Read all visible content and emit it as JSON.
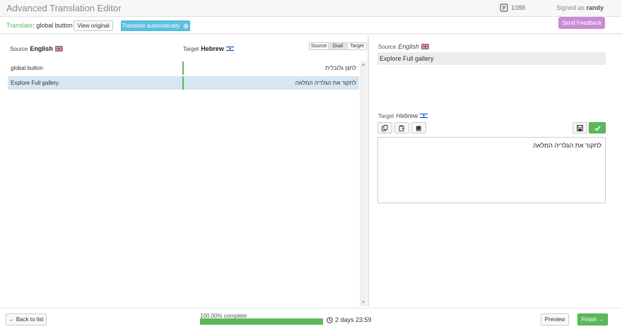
{
  "header": {
    "title": "Advanced Translation Editor",
    "credits": "1088",
    "signed_prefix": "Signed as",
    "user": "randy"
  },
  "subbar": {
    "translate_key": "Translate",
    "translate_value": ": global button",
    "view_original": "View original",
    "translate_auto": "Translate automatically",
    "send_feedback": "Send Feedback"
  },
  "list": {
    "source_label": "Source",
    "source_lang": "English",
    "target_label": "Target",
    "target_lang": "Hebrew",
    "view_modes": [
      "Source",
      "Dual",
      "Target"
    ],
    "active_mode": "Dual",
    "rows": [
      {
        "source": "global button",
        "target": "לחצן גלובלית",
        "selected": false
      },
      {
        "source": "Explore Full gallery",
        "target": "לחקור את הגלריה המלאה",
        "selected": true
      }
    ]
  },
  "editor": {
    "source_label": "Source",
    "source_lang": "English",
    "source_text": "Explore Full gallery",
    "target_label": "Target",
    "target_lang": "Hebrew",
    "target_text": "לחקור את הגלריה המלאה",
    "tools": [
      "copy-icon",
      "paste-icon",
      "book-icon"
    ],
    "save_icon": "save-icon",
    "ok_icon": "check-icon"
  },
  "footer": {
    "back": "← Back to list",
    "progress_text": "100.00% complete",
    "progress": 1.0,
    "timer": "2 days 23:59",
    "preview": "Preview",
    "finish": "Finish →"
  },
  "colors": {
    "accent": "#5cb85c",
    "info": "#5bc0de",
    "feedback": "#c98bd6",
    "selected_row": "#d6e6f2"
  }
}
